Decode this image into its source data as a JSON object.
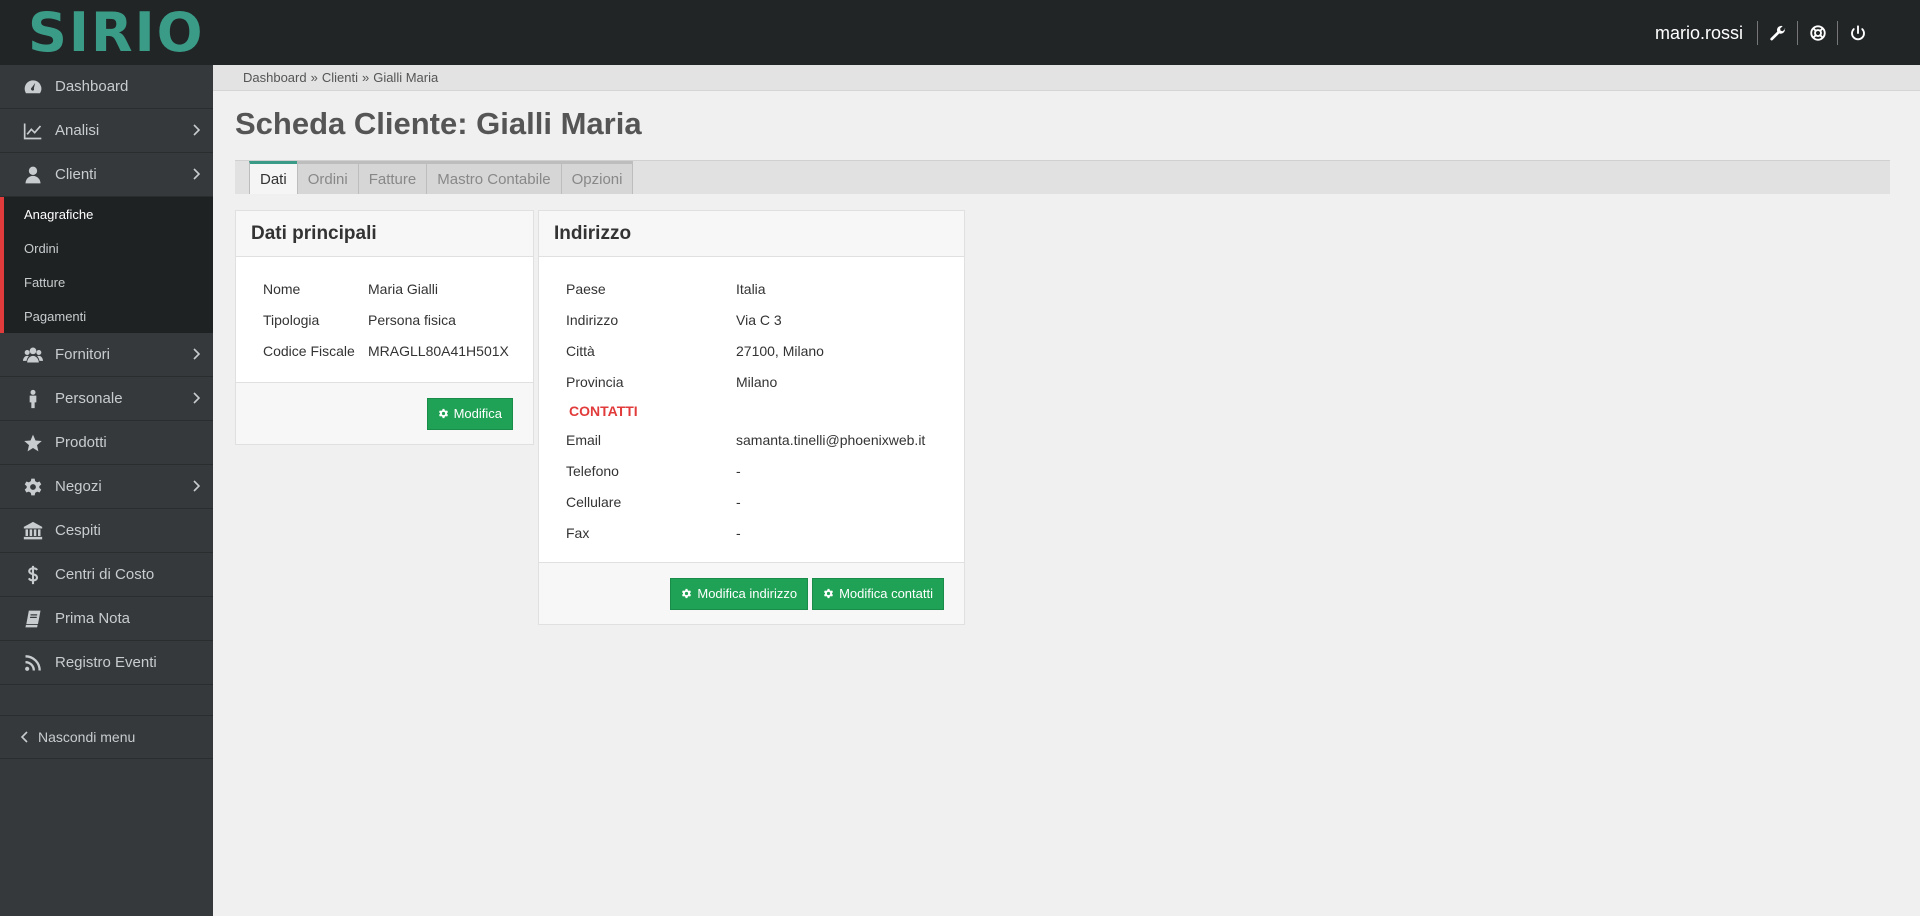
{
  "app": {
    "logo": "SIRIO",
    "username": "mario.rossi"
  },
  "header_icons": [
    "wrench-icon",
    "lifebuoy-icon",
    "power-icon"
  ],
  "sidebar": {
    "items": [
      {
        "label": "Dashboard",
        "icon": "dashboard-icon",
        "chevron": false
      },
      {
        "label": "Analisi",
        "icon": "chart-line-icon",
        "chevron": true
      },
      {
        "label": "Clienti",
        "icon": "user-icon",
        "chevron": true
      }
    ],
    "submenu": [
      "Anagrafiche",
      "Ordini",
      "Fatture",
      "Pagamenti"
    ],
    "items_after": [
      {
        "label": "Fornitori",
        "icon": "users-icon",
        "chevron": true
      },
      {
        "label": "Personale",
        "icon": "person-icon",
        "chevron": true
      },
      {
        "label": "Prodotti",
        "icon": "star-icon",
        "chevron": false
      },
      {
        "label": "Negozi",
        "icon": "gear-icon",
        "chevron": true
      },
      {
        "label": "Cespiti",
        "icon": "bank-icon",
        "chevron": false
      },
      {
        "label": "Centri di Costo",
        "icon": "dollar-icon",
        "chevron": false
      },
      {
        "label": "Prima Nota",
        "icon": "book-icon",
        "chevron": false
      },
      {
        "label": "Registro Eventi",
        "icon": "rss-icon",
        "chevron": false
      }
    ],
    "hide_menu": "Nascondi menu"
  },
  "breadcrumb": [
    "Dashboard",
    "»",
    "Clienti",
    "»",
    "Gialli Maria"
  ],
  "page_title": "Scheda Cliente: Gialli Maria",
  "tabs": [
    "Dati",
    "Ordini",
    "Fatture",
    "Mastro Contabile",
    "Opzioni"
  ],
  "dati_principali": {
    "title": "Dati principali",
    "rows": [
      {
        "label": "Nome",
        "value": "Maria Gialli"
      },
      {
        "label": "Tipologia",
        "value": "Persona fisica"
      },
      {
        "label": "Codice Fiscale",
        "value": "MRAGLL80A41H501X"
      }
    ],
    "button": "Modifica"
  },
  "indirizzo": {
    "title": "Indirizzo",
    "rows": [
      {
        "label": "Paese",
        "value": "Italia"
      },
      {
        "label": "Indirizzo",
        "value": "Via C 3"
      },
      {
        "label": "Città",
        "value": "27100, Milano"
      },
      {
        "label": "Provincia",
        "value": "Milano"
      }
    ],
    "contatti_label": "CONTATTI",
    "contatti": [
      {
        "label": "Email",
        "value": "samanta.tinelli@phoenixweb.it"
      },
      {
        "label": "Telefono",
        "value": "-"
      },
      {
        "label": "Cellulare",
        "value": "-"
      },
      {
        "label": "Fax",
        "value": "-"
      }
    ],
    "button_address": "Modifica indirizzo",
    "button_contacts": "Modifica contatti"
  },
  "colors": {
    "accent": "#3a9c87",
    "danger": "#e23b3b",
    "success": "#1fa255",
    "sidebar": "#35393b",
    "topbar": "#222526"
  }
}
